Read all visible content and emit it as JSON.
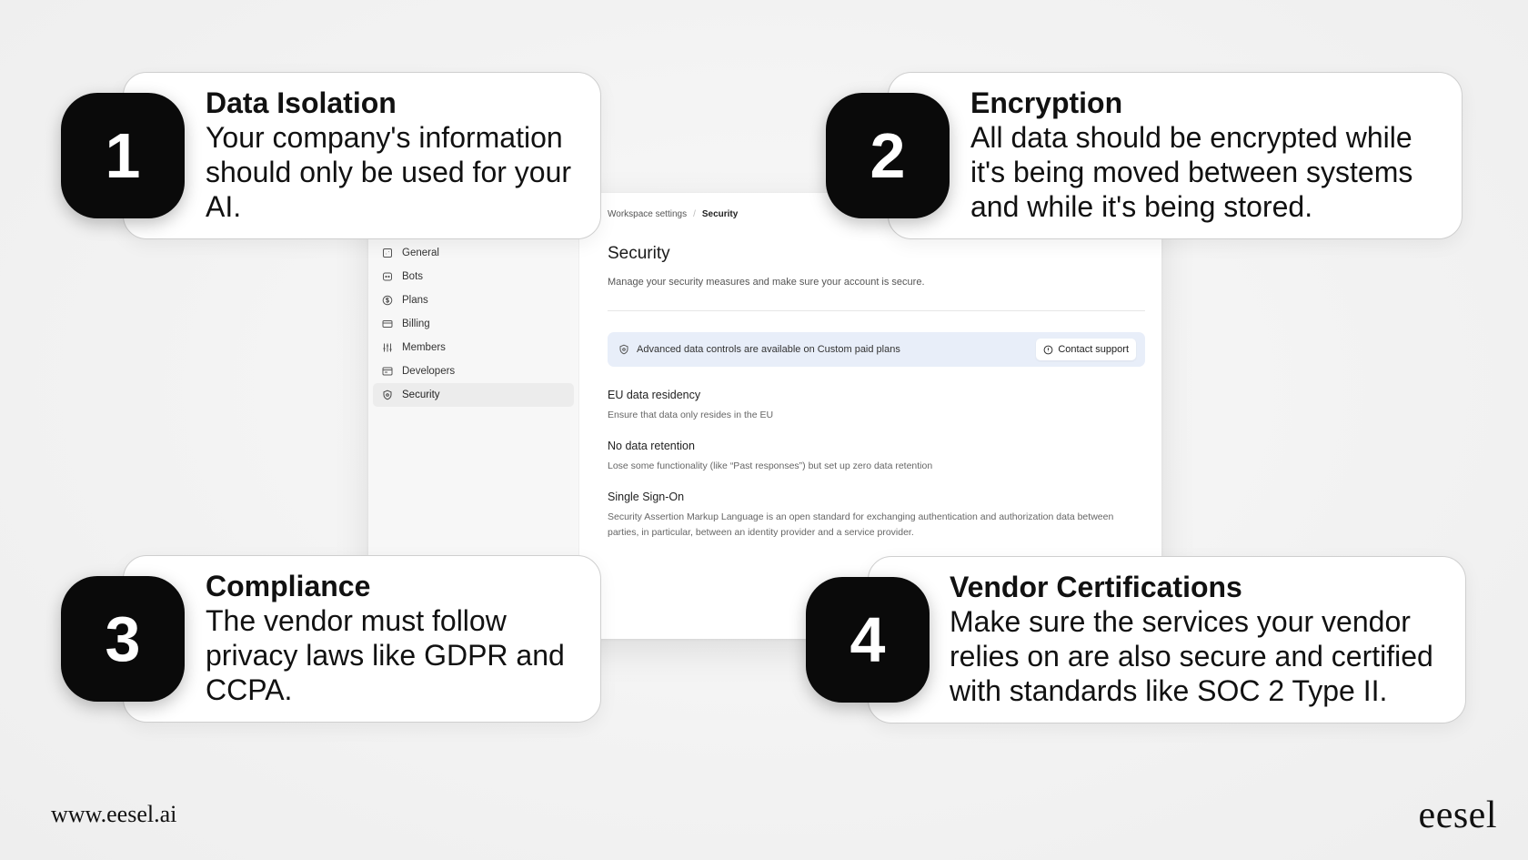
{
  "settings_window": {
    "breadcrumb": {
      "parent": "Workspace settings",
      "current": "Security"
    },
    "sidebar": {
      "items": [
        {
          "label": "General",
          "icon": "building-icon",
          "active": false
        },
        {
          "label": "Bots",
          "icon": "bot-icon",
          "active": false
        },
        {
          "label": "Plans",
          "icon": "dollar-icon",
          "active": false
        },
        {
          "label": "Billing",
          "icon": "credit-card-icon",
          "active": false
        },
        {
          "label": "Members",
          "icon": "sliders-icon",
          "active": false
        },
        {
          "label": "Developers",
          "icon": "code-icon",
          "active": false
        },
        {
          "label": "Security",
          "icon": "shield-icon",
          "active": true
        }
      ]
    },
    "page": {
      "title": "Security",
      "description": "Manage your security measures and make sure your account is secure.",
      "banner": {
        "text": "Advanced data controls are available on Custom paid plans",
        "button_label": "Contact support"
      },
      "settings": [
        {
          "title": "EU data residency",
          "description": "Ensure that data only resides in the EU"
        },
        {
          "title": "No data retention",
          "description": "Lose some functionality (like “Past responses”) but set up zero data retention"
        },
        {
          "title": "Single Sign-On",
          "description": "Security Assertion Markup Language is an open standard for exchanging authentication and authorization data between parties, in particular, between an identity provider and a service provider."
        }
      ]
    }
  },
  "callouts": [
    {
      "number": "1",
      "title": "Data Isolation",
      "body": "Your company's information should only be used for your AI."
    },
    {
      "number": "2",
      "title": "Encryption",
      "body": "All data should be encrypted while it's being moved between systems and while it's being stored."
    },
    {
      "number": "3",
      "title": "Compliance",
      "body": "The vendor must follow privacy laws like GDPR and CCPA."
    },
    {
      "number": "4",
      "title": "Vendor Certifications",
      "body": "Make sure the services your vendor relies on are also secure and certified with standards like SOC 2 Type II."
    }
  ],
  "footer": {
    "url": "www.eesel.ai",
    "logo": "eesel"
  },
  "colors": {
    "badge": "#0a0a0a",
    "banner": "#e8eef9",
    "background": "#f2f2f2"
  }
}
